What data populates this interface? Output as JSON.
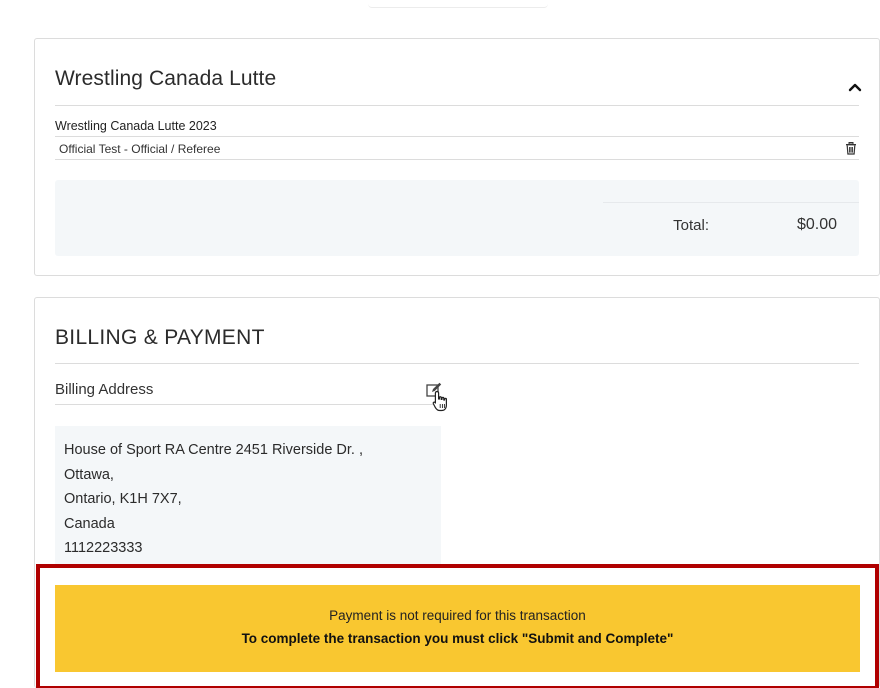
{
  "order": {
    "org_title": "Wrestling Canada Lutte",
    "event_name": "Wrestling Canada Lutte 2023",
    "line_item": "Official Test - Official / Referee",
    "total_label": "Total:",
    "total_value": "$0.00"
  },
  "billing": {
    "section_title": "BILLING & PAYMENT",
    "address_label": "Billing Address",
    "address_lines": [
      "House of Sport RA Centre 2451 Riverside Dr. ,",
      "Ottawa,",
      "Ontario, K1H 7X7,",
      "Canada",
      "1112223333"
    ]
  },
  "notice": {
    "line1": "Payment is not required for this transaction",
    "line2": "To complete the transaction you must click \"Submit and Complete\""
  },
  "icons": {
    "collapse": "chevron-up-icon",
    "delete": "trash-icon",
    "edit": "edit-icon",
    "cursor": "hand-pointer-icon"
  },
  "colors": {
    "notice_bg": "#f9c730",
    "highlight_border": "#b00000",
    "panel_bg": "#f4f7f9"
  }
}
